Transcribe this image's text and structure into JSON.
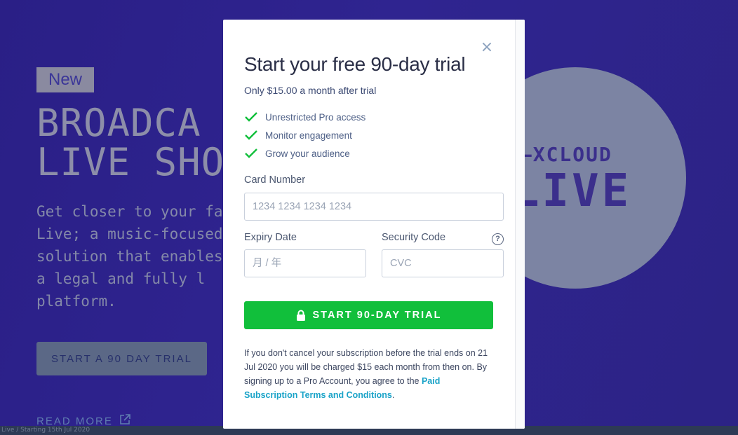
{
  "hero": {
    "badge": "New",
    "title_line1": "BROADCA",
    "title_line2": "LIVE SHO",
    "description": "Get closer to your fan Live; a music-focused solution that enables via a legal and fully l platform.",
    "cta_label": "START A 90 DAY TRIAL",
    "read_more_label": "READ MORE",
    "logo_top": "I–XCLOUD",
    "logo_bottom": "LIVE",
    "bottom_bar_text": "Live / Starting 15th Jul 2020"
  },
  "modal": {
    "title": "Start your free 90-day trial",
    "subtitle": "Only $15.00 a month after trial",
    "features": [
      {
        "label": "Unrestricted Pro access",
        "icon": "check-icon"
      },
      {
        "label": "Monitor engagement",
        "icon": "check-icon"
      },
      {
        "label": "Grow your audience",
        "icon": "check-icon"
      }
    ],
    "card_number": {
      "label": "Card Number",
      "placeholder": "1234 1234 1234 1234",
      "value": ""
    },
    "expiry": {
      "label": "Expiry Date",
      "placeholder": "月 / 年",
      "value": ""
    },
    "security": {
      "label": "Security Code",
      "placeholder": "CVC",
      "value": "",
      "help_icon": "?"
    },
    "submit_label": "START 90-DAY TRIAL",
    "disclaimer": "If you don't cancel your subscription before the trial ends on 21 Jul 2020 you will be charged $15 each month from then on. By signing up to a Pro Account, you agree to the",
    "terms_link": "Paid Subscription Terms and Conditions",
    "close_glyph": "×",
    "colors": {
      "accent": "#11bf3b",
      "link": "#1aa3c8",
      "check": "#11bf3b"
    }
  }
}
